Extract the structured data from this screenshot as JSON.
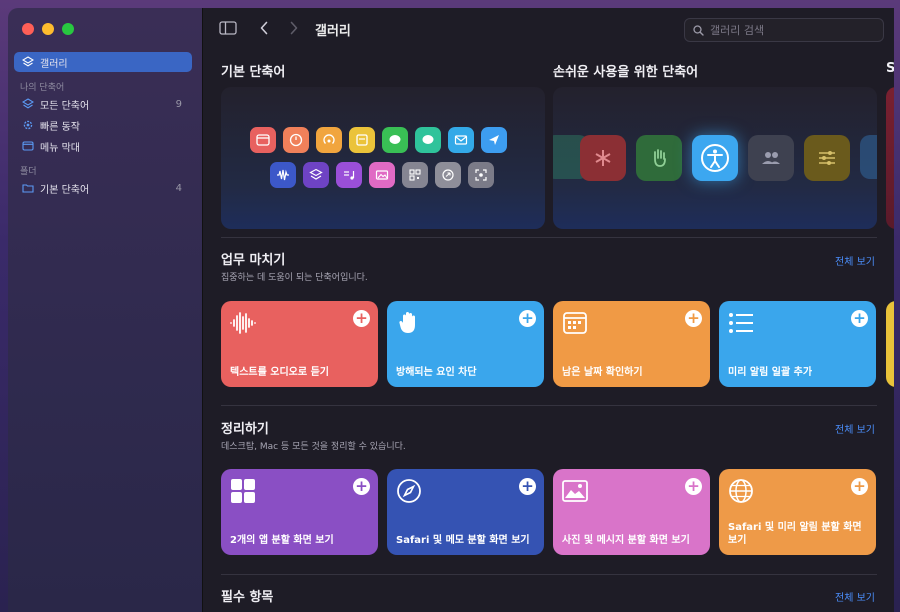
{
  "sidebar": {
    "items": [
      {
        "label": "갤러리",
        "icon": "layers-icon",
        "active": true
      },
      {
        "label": "모든 단축어",
        "icon": "grid-icon",
        "count": "9"
      },
      {
        "label": "빠른 동작",
        "icon": "gear-icon"
      },
      {
        "label": "메뉴 막대",
        "icon": "menubar-icon"
      },
      {
        "label": "기본 단축어",
        "icon": "folder-icon",
        "count": "4"
      }
    ],
    "section_my": "나의 단축어",
    "section_folder": "폴더"
  },
  "toolbar": {
    "title": "갤러리",
    "search_placeholder": "갤러리 검색"
  },
  "hero": {
    "basic_title": "기본 단축어",
    "access_title": "손쉬운 사용을 위한 단축어",
    "third_title_partial": "S"
  },
  "sections": [
    {
      "title": "업무 마치기",
      "subtitle": "집중하는 데 도움이 되는 단축어입니다.",
      "see_all": "전체 보기",
      "cards": [
        {
          "label": "텍스트를 오디오로 듣기",
          "icon": "waveform-icon",
          "color": "#e8615f"
        },
        {
          "label": "방해되는 요인 차단",
          "icon": "hand-icon",
          "color": "#3aa6ec"
        },
        {
          "label": "남은 날짜 확인하기",
          "icon": "calendar-icon",
          "color": "#f09a45"
        },
        {
          "label": "미리 알림 일괄 추가",
          "icon": "list-icon",
          "color": "#3aa6ec"
        }
      ]
    },
    {
      "title": "정리하기",
      "subtitle": "데스크탑, Mac 등 모든 것을 정리할 수 있습니다.",
      "see_all": "전체 보기",
      "cards": [
        {
          "label": "2개의 앱 분할 화면 보기",
          "icon": "four-squares-icon",
          "color": "#8a4fc4"
        },
        {
          "label": "Safari 및 메모 분할 화면 보기",
          "icon": "compass-icon",
          "color": "#3553b3"
        },
        {
          "label": "사진 및 메시지 분할 화면 보기",
          "icon": "photo-icon",
          "color": "#d974c9"
        },
        {
          "label": "Safari 및 미리 알림 분할 화면 보기",
          "icon": "globe-icon",
          "color": "#ee9a48"
        }
      ]
    },
    {
      "title": "필수 항목",
      "see_all": "전체 보기"
    }
  ]
}
